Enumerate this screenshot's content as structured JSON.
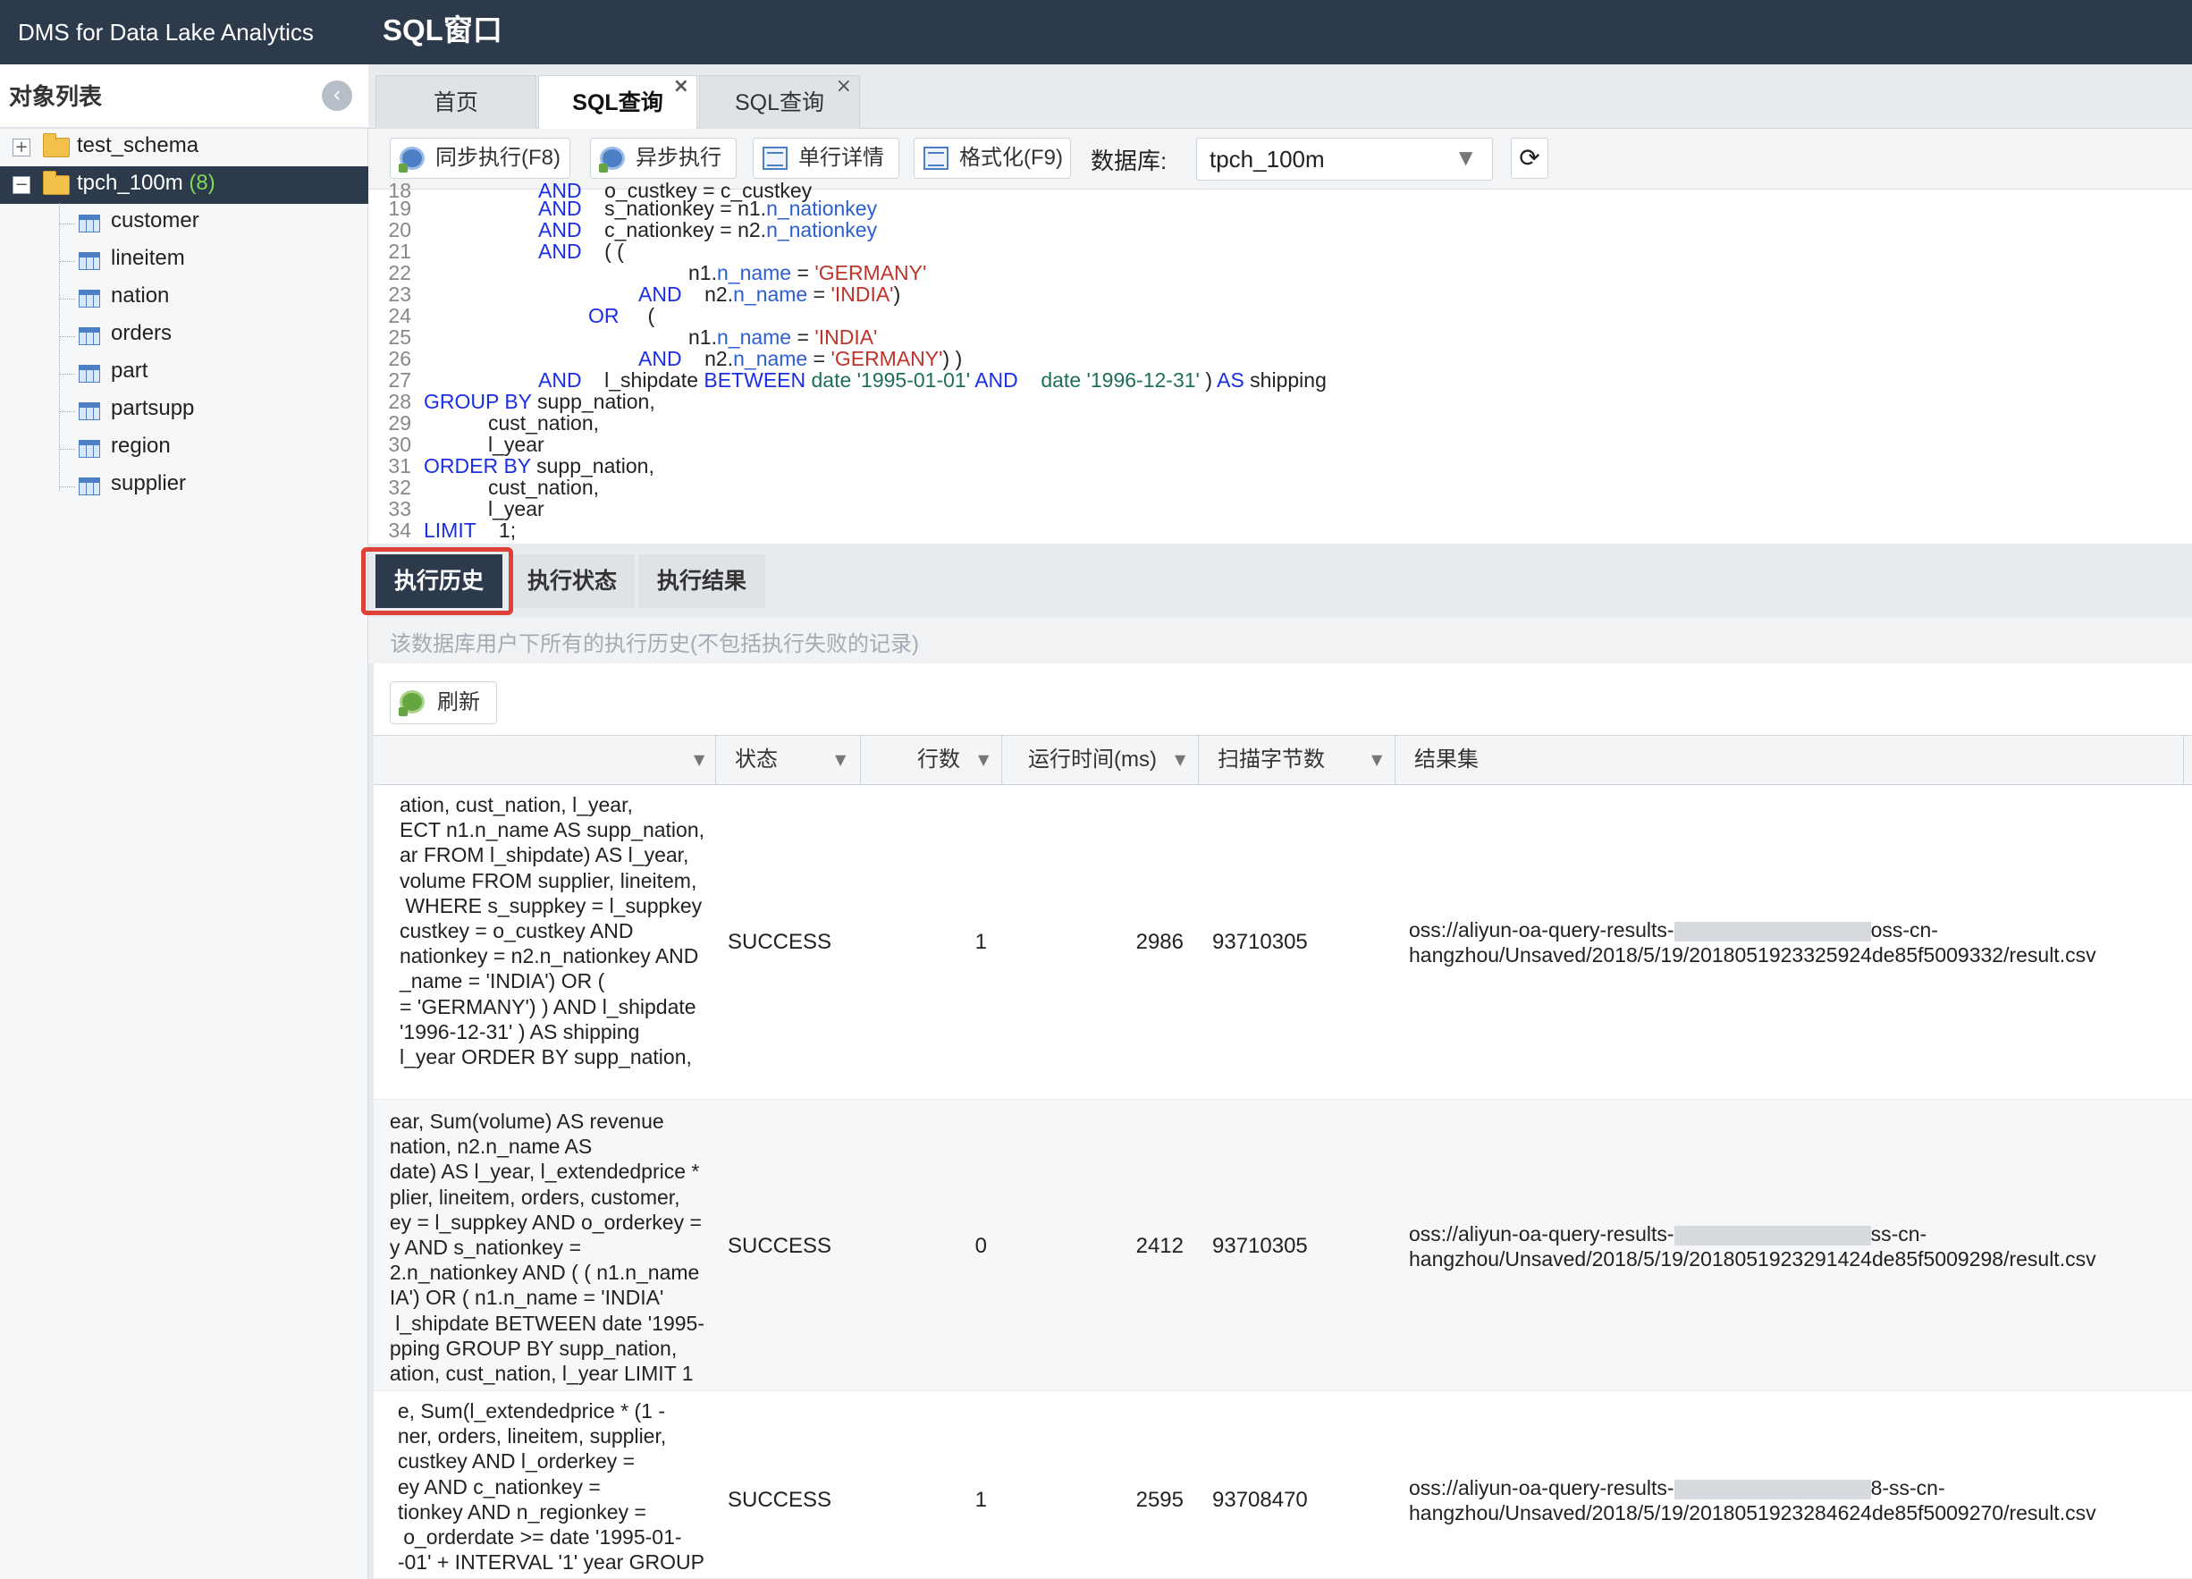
{
  "app": {
    "title": "DMS for Data Lake Analytics",
    "window_title": "SQL窗口"
  },
  "sidebar": {
    "title": "对象列表",
    "collapse_icon": "chevron-left-icon",
    "schemas": [
      {
        "name": "test_schema",
        "count": "",
        "expanded": false
      },
      {
        "name": "tpch_100m",
        "count": "(8)",
        "expanded": true
      }
    ],
    "tables": [
      "customer",
      "lineitem",
      "nation",
      "orders",
      "part",
      "partsupp",
      "region",
      "supplier"
    ]
  },
  "tabs": [
    {
      "label": "首页"
    },
    {
      "label": "SQL查询",
      "close": "×"
    },
    {
      "label": "SQL查询",
      "close": "×"
    }
  ],
  "toolbar": {
    "sync_exec": "同步执行(F8)",
    "async_exec": "异步执行",
    "row_detail": "单行详情",
    "format": "格式化(F9)",
    "db_label": "数据库:",
    "db_value": "tpch_100m"
  },
  "editor": {
    "line_numbers": [
      "19",
      "20",
      "21",
      "22",
      "23",
      "24",
      "25",
      "26",
      "27",
      "28",
      "29",
      "30",
      "31",
      "32",
      "33",
      "34"
    ],
    "lines": [
      "AND s_nationkey = n1.n_nationkey",
      "AND c_nationkey = n2.n_nationkey",
      "AND ( (",
      "n1.n_name = 'GERMANY'",
      "AND n2.n_name = 'INDIA')",
      "OR (",
      "n1.n_name = 'INDIA'",
      "AND n2.n_name = 'GERMANY') )",
      "AND l_shipdate BETWEEN date '1995-01-01' AND date '1996-12-31' ) AS shipping",
      "GROUP BY supp_nation,",
      "cust_nation,",
      "l_year",
      "ORDER BY supp_nation,",
      "cust_nation,",
      "l_year",
      "LIMIT 1;"
    ]
  },
  "result_tabs": [
    "执行历史",
    "执行状态",
    "执行结果"
  ],
  "hint": "该数据库用户下所有的执行历史(不包括执行失败的记录)",
  "refresh_label": "刷新",
  "grid": {
    "columns": [
      "状态",
      "行数",
      "运行时间(ms)",
      "扫描字节数",
      "结果集"
    ],
    "rows": [
      {
        "sql": "ation, cust_nation, l_year,\nECT n1.n_name AS supp_nation,\nar FROM l_shipdate) AS l_year,\nvolume FROM supplier, lineitem,\n WHERE s_suppkey = l_suppkey\ncustkey = o_custkey AND\nnationkey = n2.n_nationkey AND\n_name = 'INDIA') OR (\n= 'GERMANY') ) AND l_shipdate\n'1996-12-31' ) AS shipping\nl_year ORDER BY supp_nation,",
        "status": "SUCCESS",
        "rows": "1",
        "time": "2986",
        "bytes": "93710305",
        "result_1": "oss://aliyun-oa-query-results-",
        "result_1b": "oss-cn-",
        "result_2": "hangzhou/Unsaved/2018/5/19/2018051923325924de85f5009332/result.csv"
      },
      {
        "sql": "ear, Sum(volume) AS revenue\nnation, n2.n_name AS\ndate) AS l_year, l_extendedprice *\nplier, lineitem, orders, customer,\ney = l_suppkey AND o_orderkey =\ny AND s_nationkey =\n2.n_nationkey AND ( ( n1.n_name\nIA') OR ( n1.n_name = 'INDIA'\n l_shipdate BETWEEN date '1995-\npping GROUP BY supp_nation,\nation, cust_nation, l_year LIMIT 1",
        "status": "SUCCESS",
        "rows": "0",
        "time": "2412",
        "bytes": "93710305",
        "result_1": "oss://aliyun-oa-query-results-",
        "result_1b": "ss-cn-",
        "result_2": "hangzhou/Unsaved/2018/5/19/2018051923291424de85f5009298/result.csv"
      },
      {
        "sql": "e, Sum(l_extendedprice * (1 -\nner, orders, lineitem, supplier,\ncustkey AND l_orderkey =\ney AND c_nationkey =\ntionkey AND n_regionkey =\n o_orderdate >= date '1995-01-\n-01' + INTERVAL '1' year GROUP",
        "status": "SUCCESS",
        "rows": "1",
        "time": "2595",
        "bytes": "93708470",
        "result_1": "oss://aliyun-oa-query-results-",
        "result_1b": "8-ss-cn-",
        "result_2": "hangzhou/Unsaved/2018/5/19/2018051923284624de85f5009270/result.csv"
      }
    ]
  }
}
